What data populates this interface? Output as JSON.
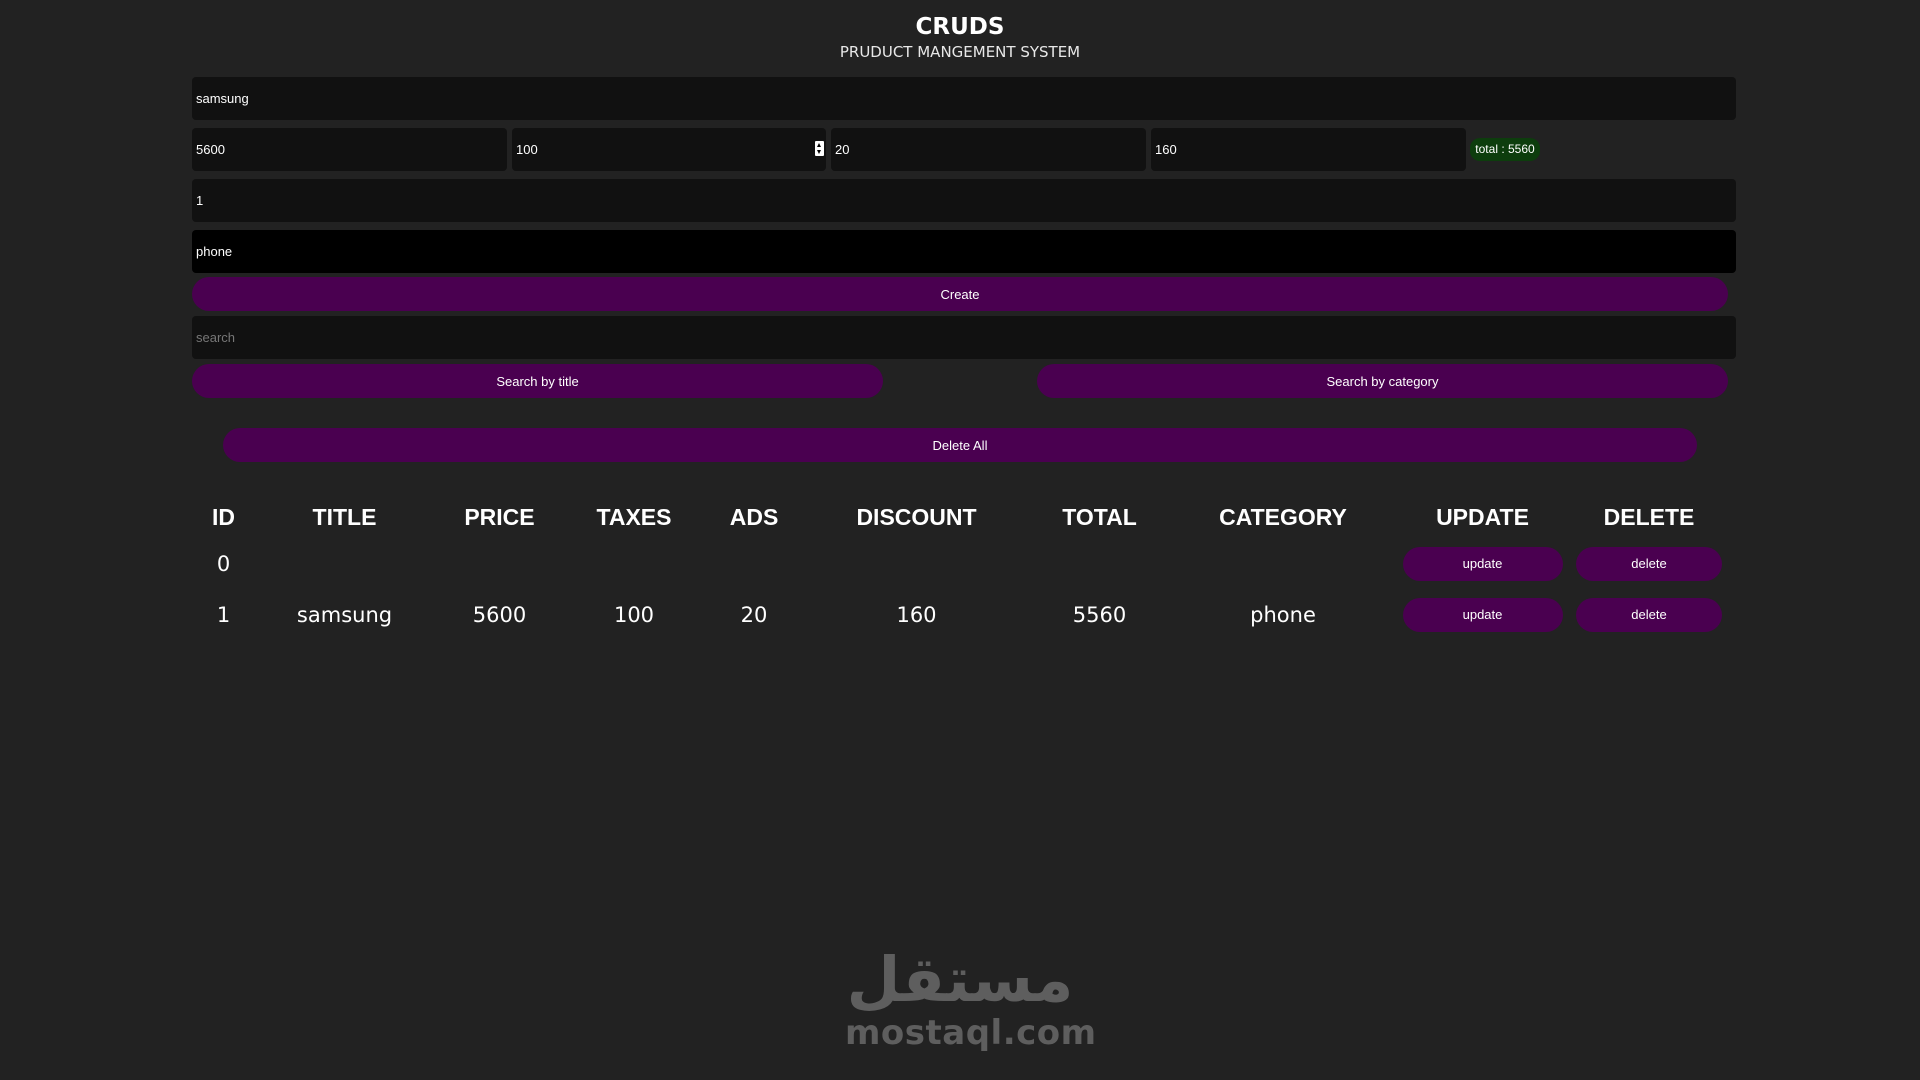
{
  "header": {
    "title": "CRUDS",
    "subtitle": "PRUDUCT MANGEMENT SYSTEM"
  },
  "form": {
    "title_value": "samsung",
    "price_value": "5600",
    "taxes_value": "100",
    "ads_value": "20",
    "discount_value": "160",
    "total_badge": "total : 5560",
    "count_value": "1",
    "category_value": "phone",
    "create_label": "Create"
  },
  "search": {
    "placeholder": "search",
    "by_title_label": "Search by title",
    "by_category_label": "Search by category"
  },
  "delete_all_label": "Delete All",
  "table": {
    "headers": [
      "ID",
      "TITLE",
      "PRICE",
      "TAXES",
      "ADS",
      "DISCOUNT",
      "TOTAL",
      "CATEGORY",
      "UPDATE",
      "DELETE"
    ],
    "rows": [
      {
        "id": "0",
        "title": "",
        "price": "",
        "taxes": "",
        "ads": "",
        "discount": "",
        "total": "",
        "category": "",
        "update_label": "update",
        "delete_label": "delete"
      },
      {
        "id": "1",
        "title": "samsung",
        "price": "5600",
        "taxes": "100",
        "ads": "20",
        "discount": "160",
        "total": "5560",
        "category": "phone",
        "update_label": "update",
        "delete_label": "delete"
      }
    ]
  },
  "watermark": {
    "arabic": "مستقل",
    "latin": "mostaql.com"
  },
  "colors": {
    "background": "#222222",
    "input_background": "#111111",
    "button_purple": "#4a0050",
    "total_badge_green": "#0d3d0d"
  }
}
